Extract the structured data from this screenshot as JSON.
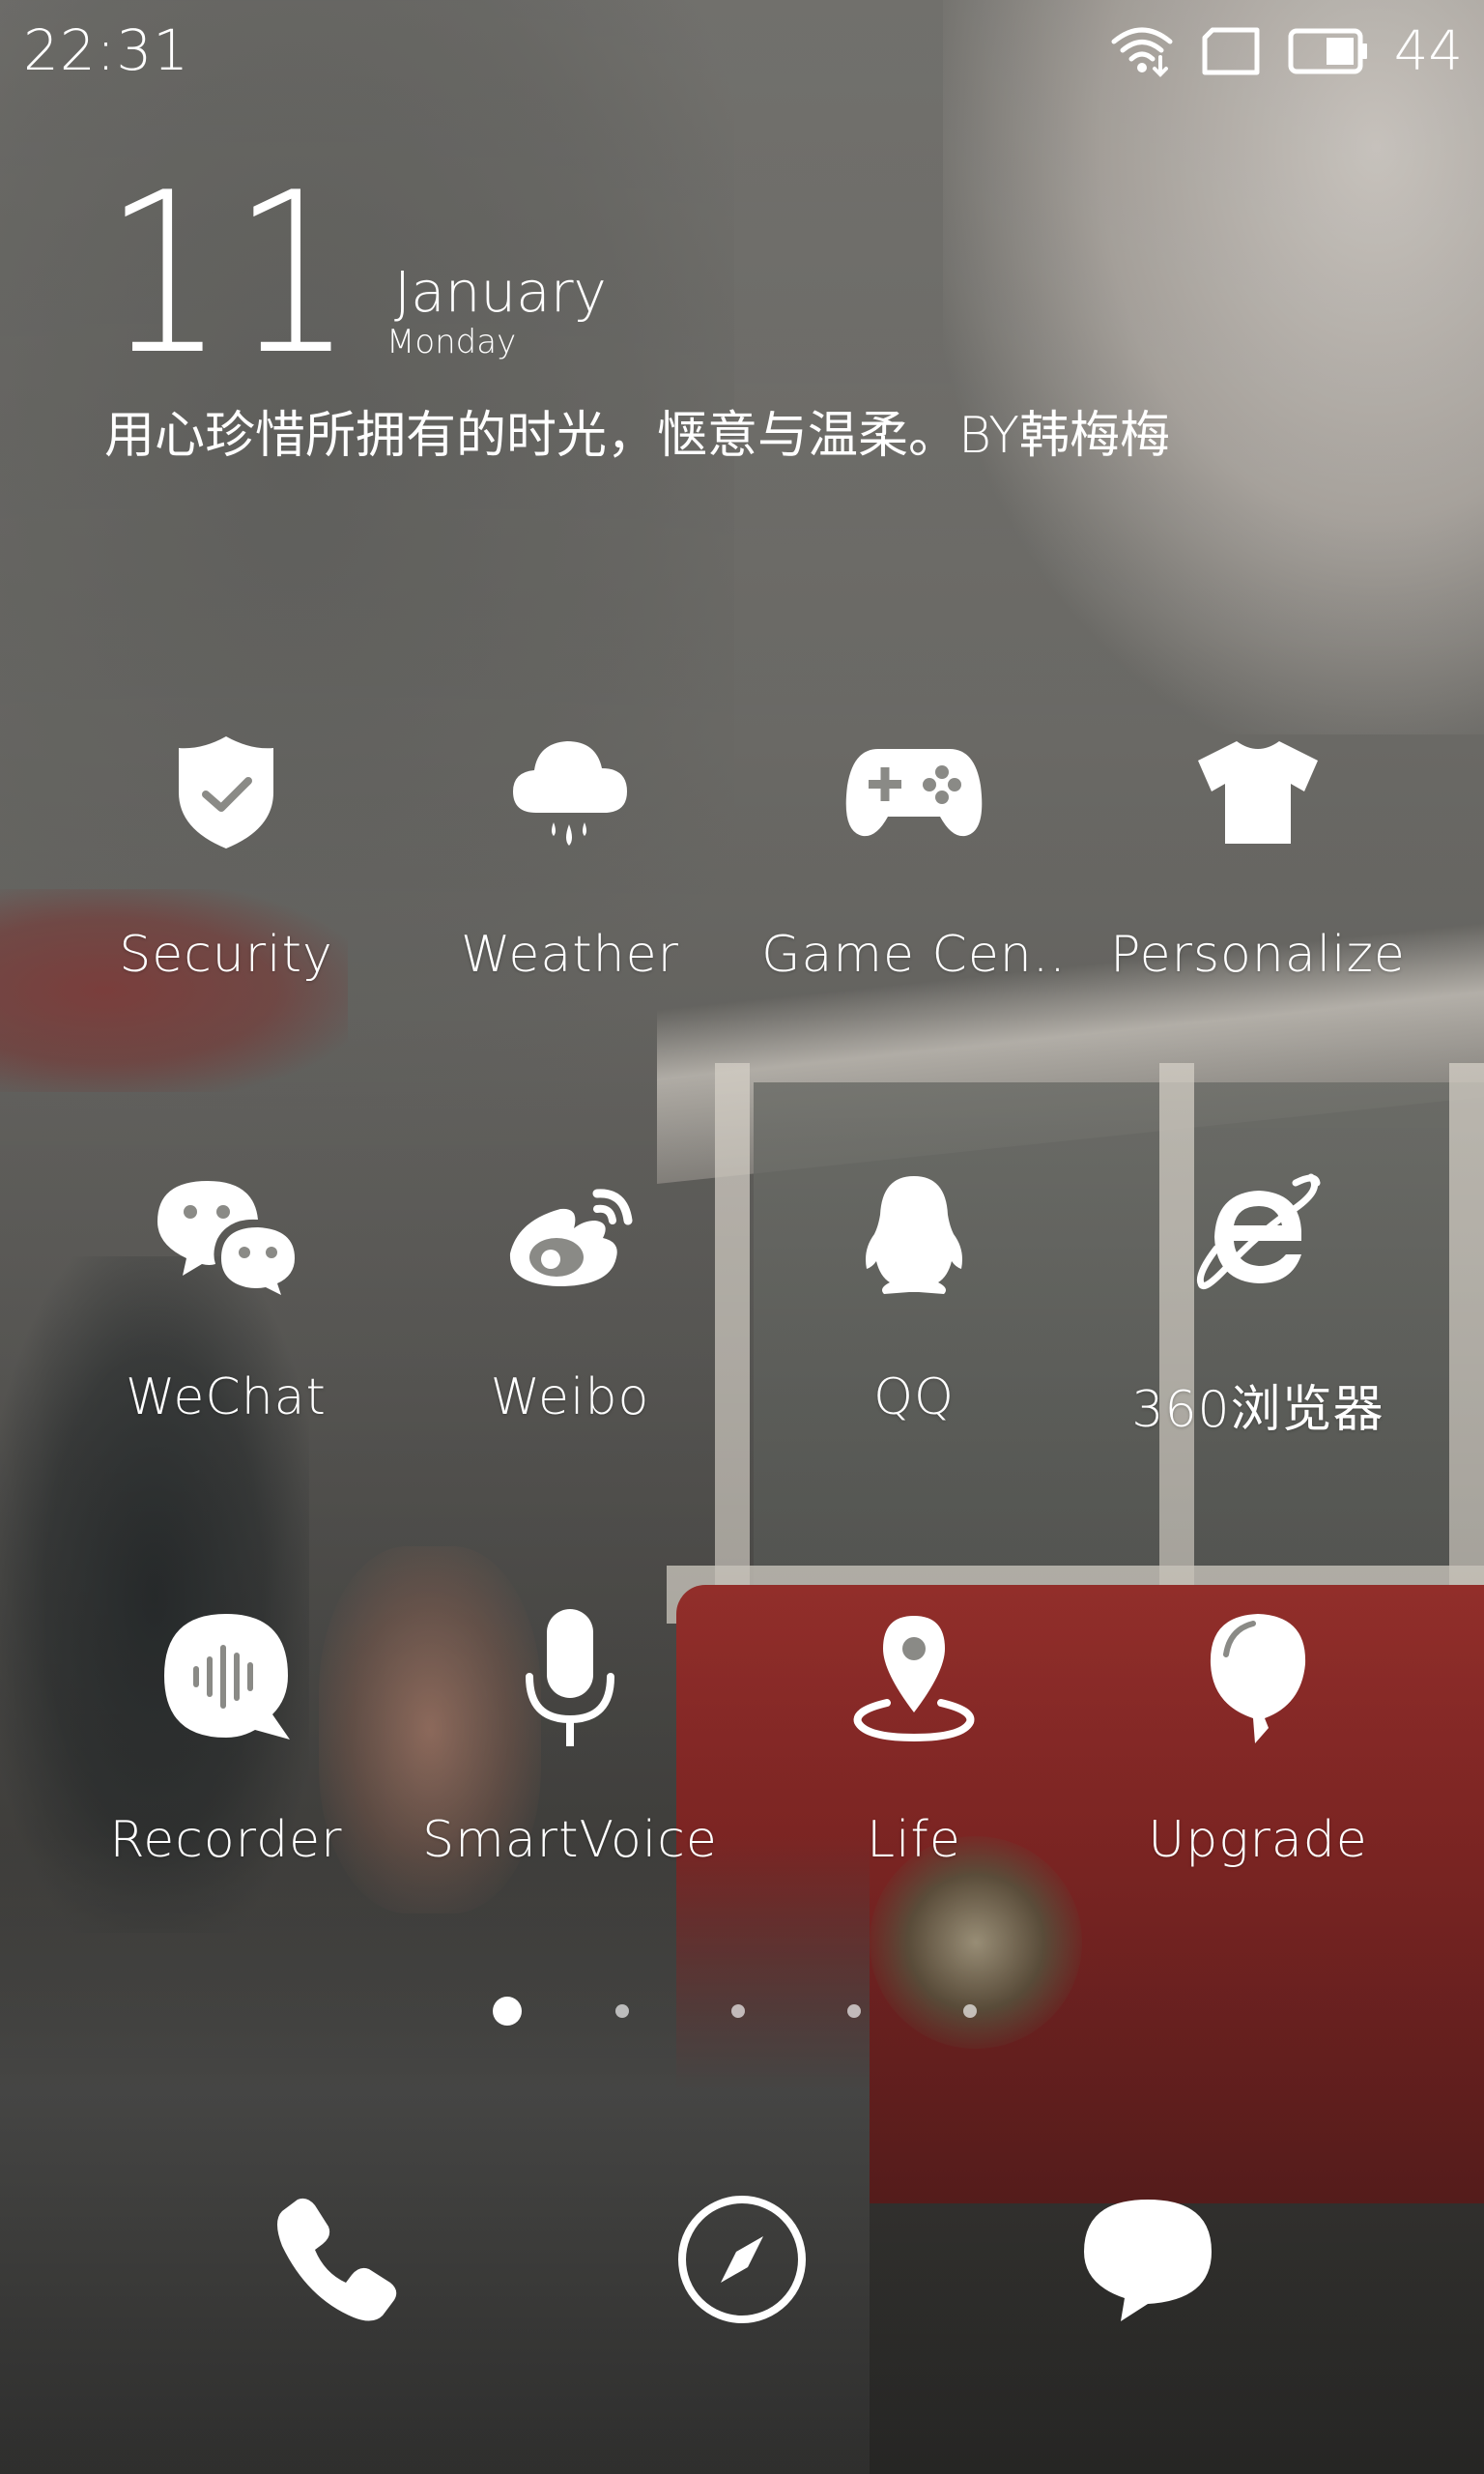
{
  "status_bar": {
    "time": "22:31",
    "battery_level": "44",
    "icons": [
      "wifi-icon",
      "sim-card-icon",
      "battery-icon"
    ]
  },
  "clock_widget": {
    "day": "11",
    "month": "January",
    "weekday": "Monday",
    "quote": "用心珍惜所拥有的时光，惬意与温柔。BY韩梅梅"
  },
  "home_screen": {
    "rows": [
      [
        {
          "label": "Security",
          "icon": "shield-check-icon"
        },
        {
          "label": "Weather",
          "icon": "cloud-rain-icon"
        },
        {
          "label": "Game Cen..",
          "icon": "gamepad-icon"
        },
        {
          "label": "Personalize",
          "icon": "tshirt-icon"
        }
      ],
      [
        {
          "label": "WeChat",
          "icon": "wechat-icon"
        },
        {
          "label": "Weibo",
          "icon": "weibo-icon"
        },
        {
          "label": "QQ",
          "icon": "qq-penguin-icon"
        },
        {
          "label": "360浏览器",
          "icon": "browser-e-icon"
        }
      ],
      [
        {
          "label": "Recorder",
          "icon": "voice-wave-icon"
        },
        {
          "label": "SmartVoice",
          "icon": "microphone-icon"
        },
        {
          "label": "Life",
          "icon": "location-pin-icon"
        },
        {
          "label": "Upgrade",
          "icon": "balloon-icon"
        }
      ]
    ]
  },
  "page_indicator": {
    "total_pages": 5,
    "current_page": 1
  },
  "dock": {
    "apps": [
      {
        "name": "Phone",
        "icon": "phone-icon"
      },
      {
        "name": "Browser",
        "icon": "compass-icon"
      },
      {
        "name": "Messages",
        "icon": "message-bubble-icon"
      }
    ]
  }
}
